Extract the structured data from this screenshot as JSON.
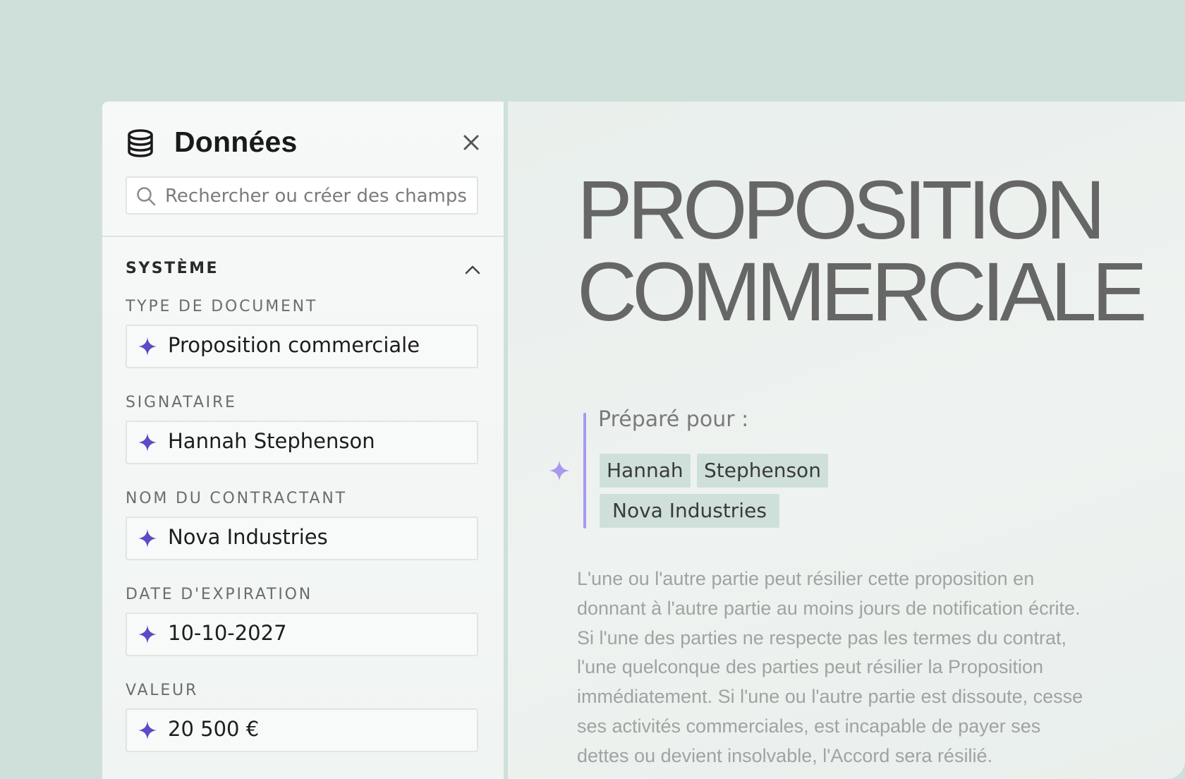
{
  "panel": {
    "title": "Données",
    "search_placeholder": "Rechercher ou créer des champs",
    "section": {
      "title": "SYSTÈME",
      "expanded": true
    },
    "fields": [
      {
        "label": "TYPE DE DOCUMENT",
        "value": "Proposition commerciale"
      },
      {
        "label": "SIGNATAIRE",
        "value": "Hannah Stephenson"
      },
      {
        "label": "NOM DU CONTRACTANT",
        "value": "Nova Industries"
      },
      {
        "label": "DATE D'EXPIRATION",
        "value": "10-10-2027"
      },
      {
        "label": "VALEUR",
        "value": "20 500 €"
      }
    ]
  },
  "document": {
    "title_line1": "PROPOSITION",
    "title_line2": "COMMERCIALE",
    "prepared_label": "Préparé pour :",
    "chips": [
      "Hannah",
      "Stephenson",
      "Nova Industries"
    ],
    "body_lines": [
      "L'une ou l'autre partie peut résilier cette proposition en",
      "donnant à l'autre partie au moins jours de notification écrite.",
      "Si l'une des parties ne respecte pas les termes du contrat,",
      "l'une quelconque des parties peut résilier la Proposition",
      "immédiatement. Si l'une ou l'autre partie est dissoute, cesse",
      "ses activités commerciales, est incapable de payer ses",
      "dettes ou devient insolvable, l'Accord sera résilié."
    ]
  },
  "colors": {
    "background": "#cfe0da",
    "accent_purple": "#5b4bc4",
    "sparkle_light": "#a899ee",
    "chip_bg": "#cfe0da",
    "title_gray": "#666666"
  },
  "icons": {
    "panel": "database-icon",
    "close": "close-icon",
    "search": "search-icon",
    "section_toggle": "chevron-up-icon",
    "field": "sparkle-icon"
  }
}
